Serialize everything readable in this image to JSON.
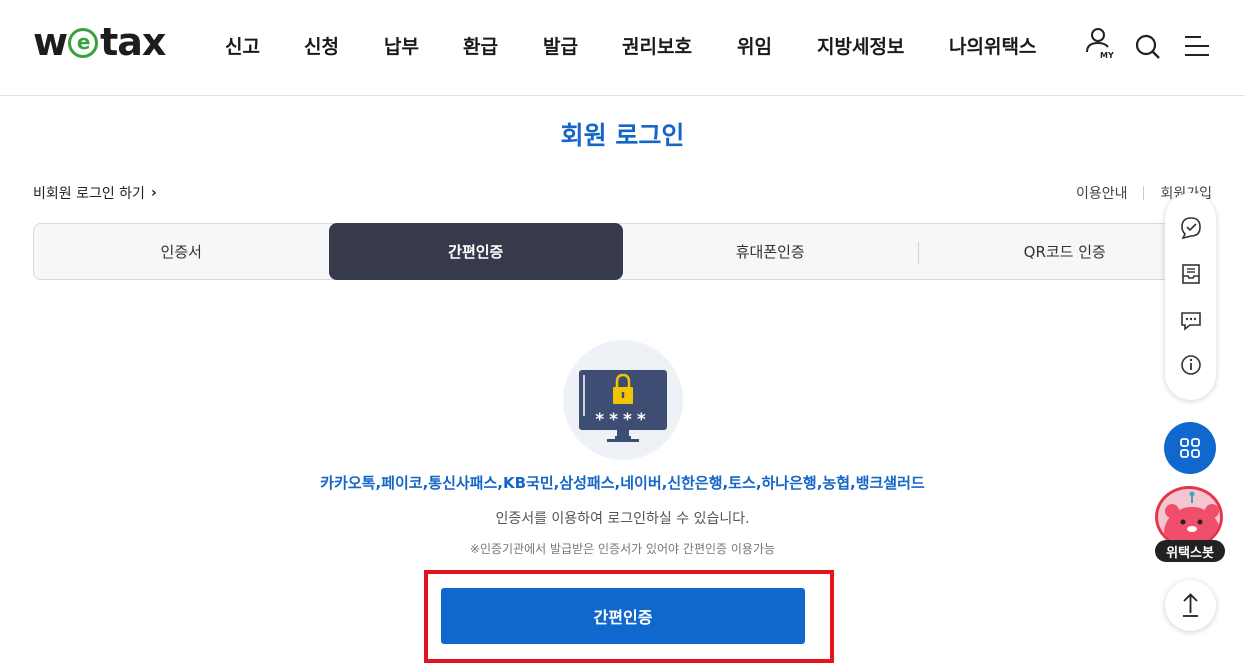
{
  "header": {
    "logo": {
      "prefix": "w",
      "e": "e",
      "suffix": "tax"
    },
    "nav": [
      "신고",
      "신청",
      "납부",
      "환급",
      "발급",
      "권리보호",
      "위임",
      "지방세정보",
      "나의위택스"
    ],
    "icons": {
      "my": "MY",
      "search": "search-icon",
      "menu": "menu-icon"
    }
  },
  "page": {
    "title": "회원 로그인",
    "guest_login": "비회원 로그인 하기",
    "usage_guide": "이용안내",
    "signup": "회원가입"
  },
  "tabs": [
    {
      "label": "인증서",
      "active": false
    },
    {
      "label": "간편인증",
      "active": true
    },
    {
      "label": "휴대폰인증",
      "active": false
    },
    {
      "label": "QR코드 인증",
      "active": false
    }
  ],
  "content": {
    "password_mask": "****",
    "providers": "카카오톡,페이코,통신사패스,KB국민,삼성패스,네이버,신한은행,토스,하나은행,농협,뱅크샐러드",
    "description": "인증서를 이용하여 로그인하실 수 있습니다.",
    "note": "※인증기관에서 발급받은 인증서가 있어야 간편인증 이용가능",
    "button": "간편인증"
  },
  "side": {
    "bot_label": "위택스봇"
  },
  "colors": {
    "brand_blue": "#1068cf",
    "title_blue": "#1466c9",
    "active_tab": "#373a4a",
    "highlight_red": "#e3141c",
    "logo_green": "#3aa23a"
  }
}
